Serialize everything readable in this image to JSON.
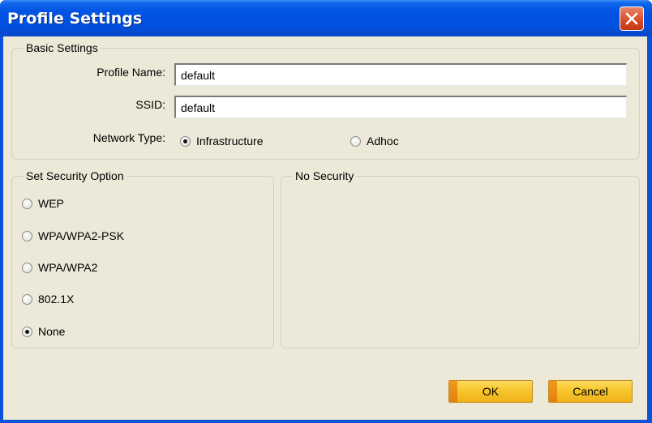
{
  "window": {
    "title": "Profile Settings"
  },
  "basic": {
    "legend": "Basic Settings",
    "profile_name_label": "Profile Name:",
    "profile_name_value": "default",
    "ssid_label": "SSID:",
    "ssid_value": "default",
    "network_type_label": "Network Type:",
    "options": [
      {
        "label": "Infrastructure",
        "selected": true
      },
      {
        "label": "Adhoc",
        "selected": false
      }
    ]
  },
  "security": {
    "legend": "Set Security Option",
    "options": [
      {
        "label": "WEP",
        "selected": false
      },
      {
        "label": "WPA/WPA2-PSK",
        "selected": false
      },
      {
        "label": "WPA/WPA2",
        "selected": false
      },
      {
        "label": "802.1X",
        "selected": false
      },
      {
        "label": "None",
        "selected": true
      }
    ]
  },
  "detail": {
    "legend": "No Security"
  },
  "buttons": {
    "ok": "OK",
    "cancel": "Cancel"
  },
  "colors": {
    "titlebar": "#0054e3",
    "dialog_bg": "#ece9d8",
    "button": "#f7c52d",
    "close": "#d64b27"
  }
}
